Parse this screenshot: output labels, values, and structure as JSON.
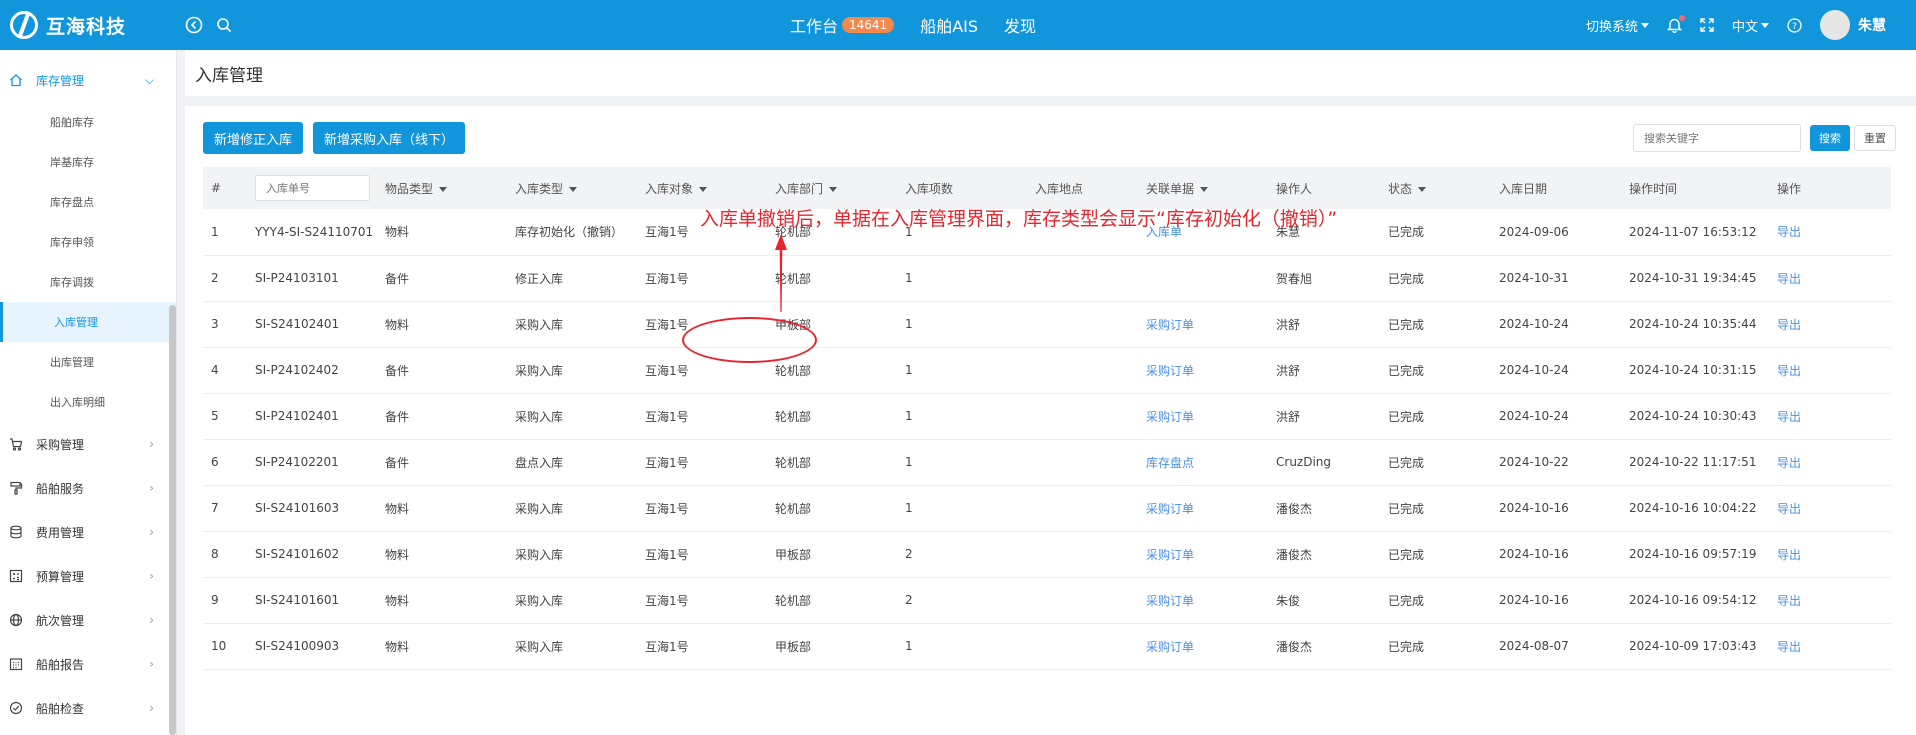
{
  "brand": {
    "name": "互海科技"
  },
  "topnav": {
    "workbench": "工作台",
    "workbench_badge": "14641",
    "ais": "船舶AIS",
    "discover": "发现",
    "switch_system": "切换系统",
    "language": "中文",
    "username": "朱慧"
  },
  "sidebar": {
    "inventory": "库存管理",
    "inventory_items": [
      "船舶库存",
      "岸基库存",
      "库存盘点",
      "库存申领",
      "库存调拨",
      "入库管理",
      "出库管理",
      "出入库明细"
    ],
    "groups": [
      "采购管理",
      "船舶服务",
      "费用管理",
      "预算管理",
      "航次管理",
      "船舶报告",
      "船舶检查"
    ]
  },
  "page": {
    "title": "入库管理"
  },
  "toolbar": {
    "add_correction": "新增修正入库",
    "add_purchase": "新增采购入库（线下）"
  },
  "search": {
    "placeholder": "搜索关键字",
    "search_label": "搜索",
    "reset_label": "重置"
  },
  "annotation": {
    "text": "入库单撤销后，单据在入库管理界面，库存类型会显示“库存初始化（撤销）”"
  },
  "table": {
    "headers": {
      "index": "#",
      "order_placeholder": "入库单号",
      "item_type": "物品类型",
      "in_type": "入库类型",
      "target": "入库对象",
      "dept": "入库部门",
      "count": "入库项数",
      "location": "入库地点",
      "related": "关联单据",
      "operator": "操作人",
      "status": "状态",
      "date": "入库日期",
      "op_time": "操作时间",
      "action": "操作"
    },
    "rows": [
      {
        "no": "1",
        "order": "YYY4-SI-S24110701",
        "item_type": "物料",
        "in_type": "库存初始化（撤销）",
        "target": "互海1号",
        "dept": "轮机部",
        "count": "1",
        "location": "",
        "related": "入库单",
        "operator": "朱慧",
        "status": "已完成",
        "date": "2024-09-06",
        "op_time": "2024-11-07 16:53:12",
        "action": "导出"
      },
      {
        "no": "2",
        "order": "SI-P24103101",
        "item_type": "备件",
        "in_type": "修正入库",
        "target": "互海1号",
        "dept": "轮机部",
        "count": "1",
        "location": "",
        "related": "",
        "operator": "贺春旭",
        "status": "已完成",
        "date": "2024-10-31",
        "op_time": "2024-10-31 19:34:45",
        "action": "导出"
      },
      {
        "no": "3",
        "order": "SI-S24102401",
        "item_type": "物料",
        "in_type": "采购入库",
        "target": "互海1号",
        "dept": "甲板部",
        "count": "1",
        "location": "",
        "related": "采购订单",
        "operator": "洪舒",
        "status": "已完成",
        "date": "2024-10-24",
        "op_time": "2024-10-24 10:35:44",
        "action": "导出"
      },
      {
        "no": "4",
        "order": "SI-P24102402",
        "item_type": "备件",
        "in_type": "采购入库",
        "target": "互海1号",
        "dept": "轮机部",
        "count": "1",
        "location": "",
        "related": "采购订单",
        "operator": "洪舒",
        "status": "已完成",
        "date": "2024-10-24",
        "op_time": "2024-10-24 10:31:15",
        "action": "导出"
      },
      {
        "no": "5",
        "order": "SI-P24102401",
        "item_type": "备件",
        "in_type": "采购入库",
        "target": "互海1号",
        "dept": "轮机部",
        "count": "1",
        "location": "",
        "related": "采购订单",
        "operator": "洪舒",
        "status": "已完成",
        "date": "2024-10-24",
        "op_time": "2024-10-24 10:30:43",
        "action": "导出"
      },
      {
        "no": "6",
        "order": "SI-P24102201",
        "item_type": "备件",
        "in_type": "盘点入库",
        "target": "互海1号",
        "dept": "轮机部",
        "count": "1",
        "location": "",
        "related": "库存盘点",
        "operator": "CruzDing",
        "status": "已完成",
        "date": "2024-10-22",
        "op_time": "2024-10-22 11:17:51",
        "action": "导出"
      },
      {
        "no": "7",
        "order": "SI-S24101603",
        "item_type": "物料",
        "in_type": "采购入库",
        "target": "互海1号",
        "dept": "轮机部",
        "count": "1",
        "location": "",
        "related": "采购订单",
        "operator": "潘俊杰",
        "status": "已完成",
        "date": "2024-10-16",
        "op_time": "2024-10-16 10:04:22",
        "action": "导出"
      },
      {
        "no": "8",
        "order": "SI-S24101602",
        "item_type": "物料",
        "in_type": "采购入库",
        "target": "互海1号",
        "dept": "甲板部",
        "count": "2",
        "location": "",
        "related": "采购订单",
        "operator": "潘俊杰",
        "status": "已完成",
        "date": "2024-10-16",
        "op_time": "2024-10-16 09:57:19",
        "action": "导出"
      },
      {
        "no": "9",
        "order": "SI-S24101601",
        "item_type": "物料",
        "in_type": "采购入库",
        "target": "互海1号",
        "dept": "轮机部",
        "count": "2",
        "location": "",
        "related": "采购订单",
        "operator": "朱俊",
        "status": "已完成",
        "date": "2024-10-16",
        "op_time": "2024-10-16 09:54:12",
        "action": "导出"
      },
      {
        "no": "10",
        "order": "SI-S24100903",
        "item_type": "物料",
        "in_type": "采购入库",
        "target": "互海1号",
        "dept": "甲板部",
        "count": "1",
        "location": "",
        "related": "采购订单",
        "operator": "潘俊杰",
        "status": "已完成",
        "date": "2024-08-07",
        "op_time": "2024-10-09 17:03:43",
        "action": "导出"
      }
    ]
  },
  "colors": {
    "primary": "#1296db",
    "annotation": "#e6262f",
    "badge": "#f5894c",
    "link": "#4a90e2"
  },
  "icons": {
    "topbar": [
      "back-circle-icon",
      "search-icon",
      "bell-icon",
      "fullscreen-icon",
      "help-icon"
    ],
    "sidebar": [
      "home-icon",
      "cart-icon",
      "paint-roller-icon",
      "database-icon",
      "calculator-icon",
      "globe-icon",
      "calendar-icon",
      "check-circle-icon"
    ]
  }
}
